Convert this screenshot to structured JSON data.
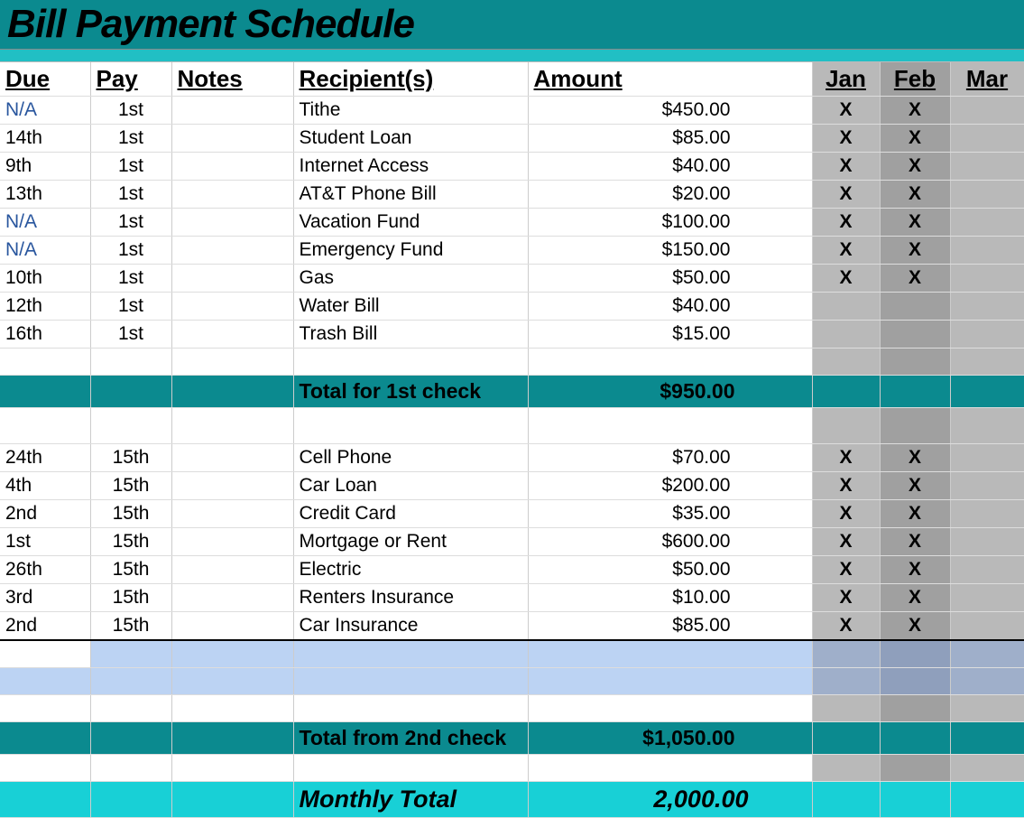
{
  "title": "Bill Payment Schedule",
  "headers": {
    "due": "Due",
    "pay": "Pay",
    "notes": "Notes",
    "recipient": "Recipient(s)",
    "amount": "Amount",
    "jan": "Jan",
    "feb": "Feb",
    "mar": "Mar"
  },
  "group1": [
    {
      "due": "N/A",
      "na": true,
      "pay": "1st",
      "notes": "",
      "rec": "Tithe",
      "amt": "$450.00",
      "jan": "X",
      "feb": "X",
      "mar": ""
    },
    {
      "due": "14th",
      "na": false,
      "pay": "1st",
      "notes": "",
      "rec": "Student Loan",
      "amt": "$85.00",
      "jan": "X",
      "feb": "X",
      "mar": ""
    },
    {
      "due": "9th",
      "na": false,
      "pay": "1st",
      "notes": "",
      "rec": "Internet Access",
      "amt": "$40.00",
      "jan": "X",
      "feb": "X",
      "mar": ""
    },
    {
      "due": "13th",
      "na": false,
      "pay": "1st",
      "notes": "",
      "rec": "AT&T Phone Bill",
      "amt": "$20.00",
      "jan": "X",
      "feb": "X",
      "mar": ""
    },
    {
      "due": "N/A",
      "na": true,
      "pay": "1st",
      "notes": "",
      "rec": "Vacation Fund",
      "amt": "$100.00",
      "jan": "X",
      "feb": "X",
      "mar": ""
    },
    {
      "due": "N/A",
      "na": true,
      "pay": "1st",
      "notes": "",
      "rec": "Emergency Fund",
      "amt": "$150.00",
      "jan": "X",
      "feb": "X",
      "mar": ""
    },
    {
      "due": "10th",
      "na": false,
      "pay": "1st",
      "notes": "",
      "rec": "Gas",
      "amt": "$50.00",
      "jan": "X",
      "feb": "X",
      "mar": ""
    },
    {
      "due": "12th",
      "na": false,
      "pay": "1st",
      "notes": "",
      "rec": "Water Bill",
      "amt": "$40.00",
      "jan": "",
      "feb": "",
      "mar": ""
    },
    {
      "due": "16th",
      "na": false,
      "pay": "1st",
      "notes": "",
      "rec": "Trash Bill",
      "amt": "$15.00",
      "jan": "",
      "feb": "",
      "mar": ""
    }
  ],
  "total1": {
    "label": "Total for 1st check",
    "amt": "$950.00"
  },
  "group2": [
    {
      "due": "24th",
      "na": false,
      "pay": "15th",
      "notes": "",
      "rec": "Cell Phone",
      "amt": "$70.00",
      "jan": "X",
      "feb": "X",
      "mar": ""
    },
    {
      "due": "4th",
      "na": false,
      "pay": "15th",
      "notes": "",
      "rec": "Car Loan",
      "amt": "$200.00",
      "jan": "X",
      "feb": "X",
      "mar": ""
    },
    {
      "due": "2nd",
      "na": false,
      "pay": "15th",
      "notes": "",
      "rec": "Credit Card",
      "amt": "$35.00",
      "jan": "X",
      "feb": "X",
      "mar": ""
    },
    {
      "due": "1st",
      "na": false,
      "pay": "15th",
      "notes": "",
      "rec": "Mortgage or Rent",
      "amt": "$600.00",
      "jan": "X",
      "feb": "X",
      "mar": ""
    },
    {
      "due": "26th",
      "na": false,
      "pay": "15th",
      "notes": "",
      "rec": "Electric",
      "amt": "$50.00",
      "jan": "X",
      "feb": "X",
      "mar": ""
    },
    {
      "due": "3rd",
      "na": false,
      "pay": "15th",
      "notes": "",
      "rec": "Renters Insurance",
      "amt": "$10.00",
      "jan": "X",
      "feb": "X",
      "mar": ""
    },
    {
      "due": "2nd",
      "na": false,
      "pay": "15th",
      "notes": "",
      "rec": "Car Insurance",
      "amt": "$85.00",
      "jan": "X",
      "feb": "X",
      "mar": ""
    }
  ],
  "total2": {
    "label": "Total from 2nd check",
    "amt": "$1,050.00"
  },
  "grand": {
    "label": "Monthly Total",
    "amt": "2,000.00"
  }
}
